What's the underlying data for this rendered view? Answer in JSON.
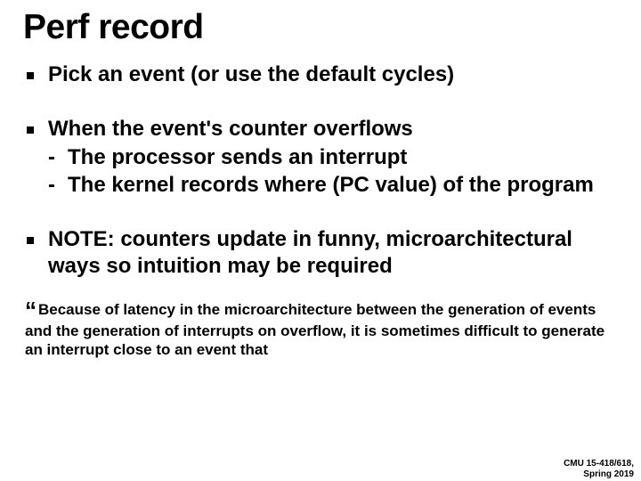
{
  "title": "Perf record",
  "bullets": [
    {
      "text": "Pick an event (or use the default cycles)",
      "sub": []
    },
    {
      "text": "When the event's counter overflows",
      "sub": [
        "The processor sends an interrupt",
        "The kernel records where (PC value) of the program"
      ]
    },
    {
      "text": "NOTE: counters update in funny, microarchitectural ways so intuition may be required",
      "sub": []
    }
  ],
  "quote": "Because of latency in the microarchitecture between the generation of events and the generation of interrupts on overflow, it is sometimes difficult to generate an interrupt close to an event that",
  "footer_line1": "CMU 15-418/618,",
  "footer_line2": "Spring 2019"
}
